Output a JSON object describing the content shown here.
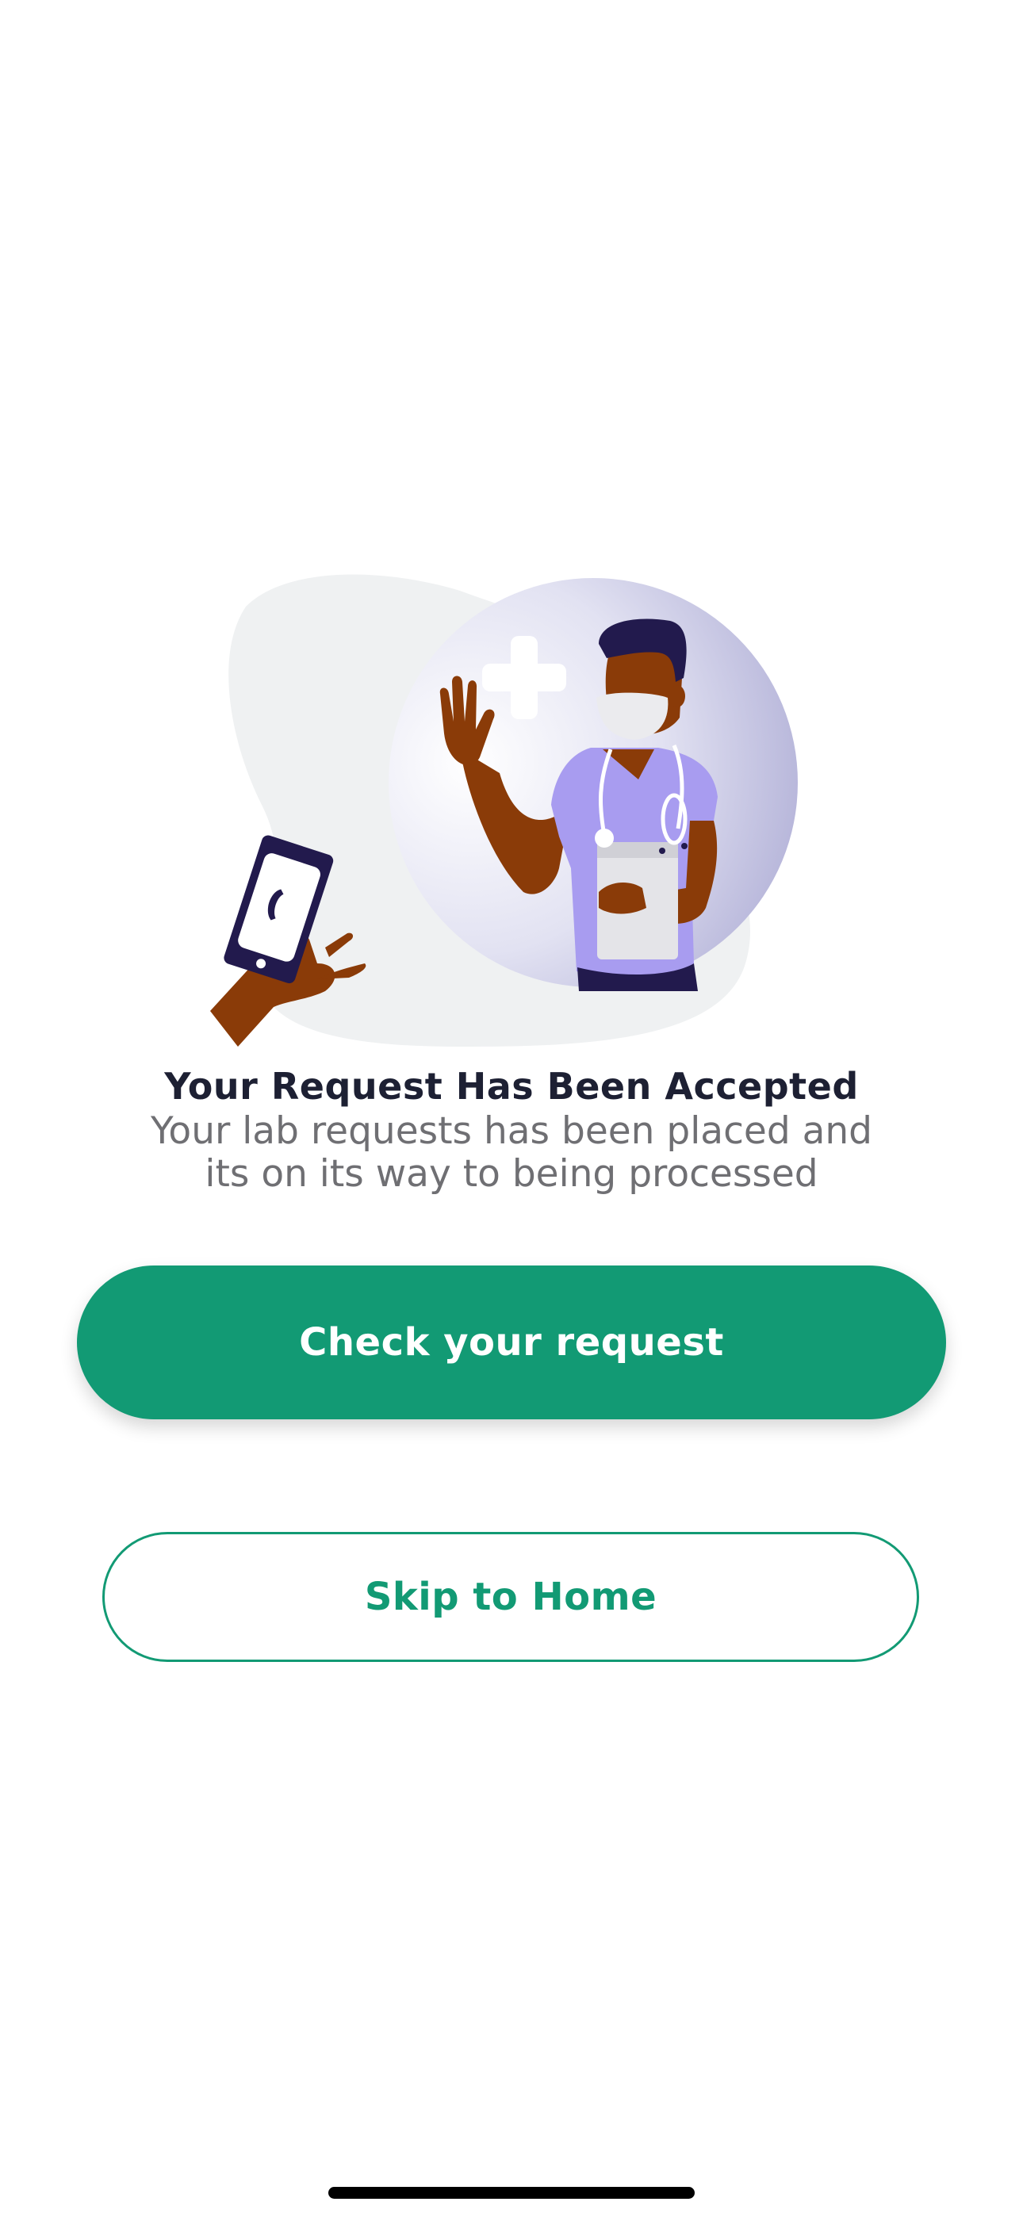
{
  "confirmation": {
    "title": "Your Request Has Been Accepted",
    "message_line1": "Your lab requests has been placed and",
    "message_line2": "its on its way to being processed"
  },
  "actions": {
    "primary_label": "Check your request",
    "secondary_label": "Skip to Home"
  },
  "colors": {
    "accent": "#129a74",
    "title_text": "#1d2033",
    "body_text": "#6f6f73",
    "scrub_purple": "#a89cf0",
    "phone_frame": "#221a4d"
  },
  "illustration": {
    "icon": "doctor-illustration",
    "parts": [
      "hand-holding-phone",
      "medical-cross-icon",
      "masked-nurse-with-stethoscope"
    ]
  }
}
